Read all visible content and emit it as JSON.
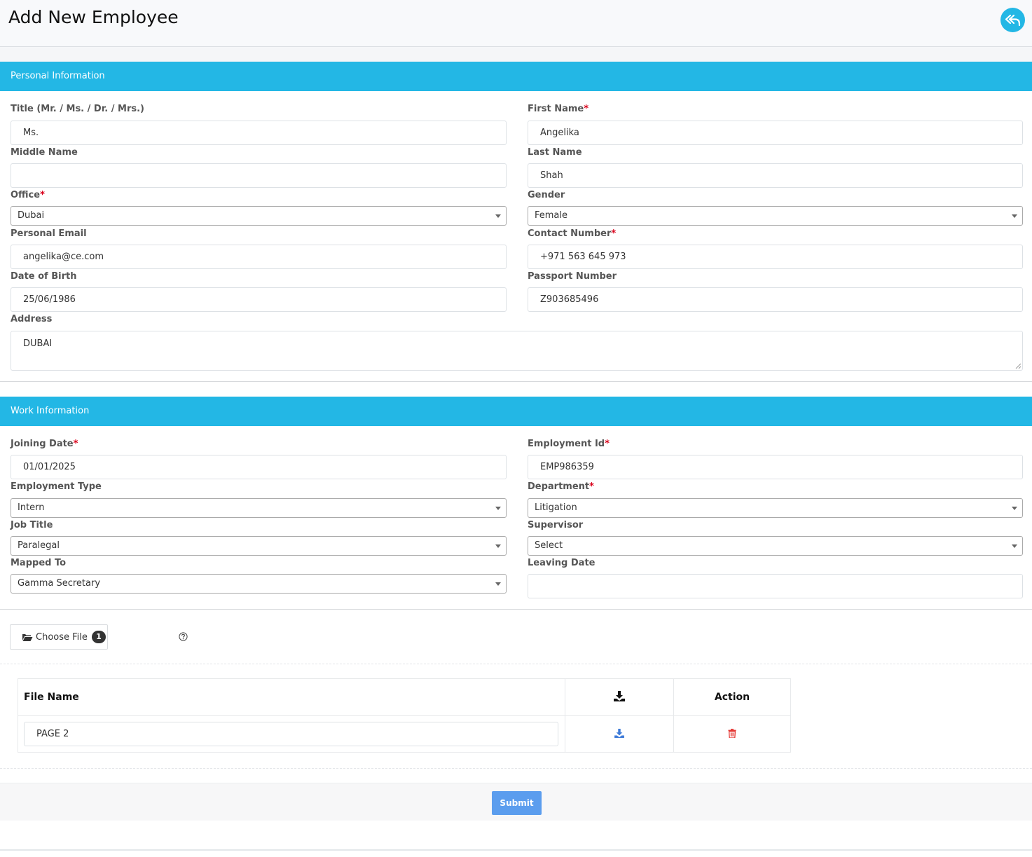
{
  "header": {
    "title": "Add New Employee"
  },
  "personal": {
    "section_title": "Personal Information",
    "title_label": "Title (Mr. / Ms. / Dr. / Mrs.)",
    "title_value": "Ms.",
    "first_name_label": "First Name",
    "first_name_value": "Angelika",
    "middle_name_label": "Middle Name",
    "middle_name_value": "",
    "last_name_label": "Last Name",
    "last_name_value": "Shah",
    "office_label": "Office",
    "office_value": "Dubai",
    "gender_label": "Gender",
    "gender_value": "Female",
    "email_label": "Personal Email",
    "email_value": "angelika@ce.com",
    "contact_label": "Contact Number",
    "contact_value": "+971 563 645 973",
    "dob_label": "Date of Birth",
    "dob_value": "25/06/1986",
    "passport_label": "Passport Number",
    "passport_value": "Z903685496",
    "address_label": "Address",
    "address_value": "DUBAI"
  },
  "work": {
    "section_title": "Work Information",
    "joining_label": "Joining Date",
    "joining_value": "01/01/2025",
    "emp_id_label": "Employment Id",
    "emp_id_value": "EMP986359",
    "emp_type_label": "Employment Type",
    "emp_type_value": "Intern",
    "department_label": "Department",
    "department_value": "Litigation",
    "job_title_label": "Job Title",
    "job_title_value": "Paralegal",
    "supervisor_label": "Supervisor",
    "supervisor_value": "Select",
    "mapped_label": "Mapped To",
    "mapped_value": "Gamma Secretary",
    "leaving_label": "Leaving Date",
    "leaving_value": ""
  },
  "upload": {
    "choose_label": "Choose File",
    "count": "1"
  },
  "files": {
    "col_name": "File Name",
    "col_action": "Action",
    "rows": [
      {
        "name": "PAGE 2"
      }
    ]
  },
  "footer": {
    "submit_label": "Submit"
  },
  "colors": {
    "accent": "#23b7e5",
    "submit": "#5b9dee",
    "required": "#d9001b",
    "delete": "#e53935"
  }
}
